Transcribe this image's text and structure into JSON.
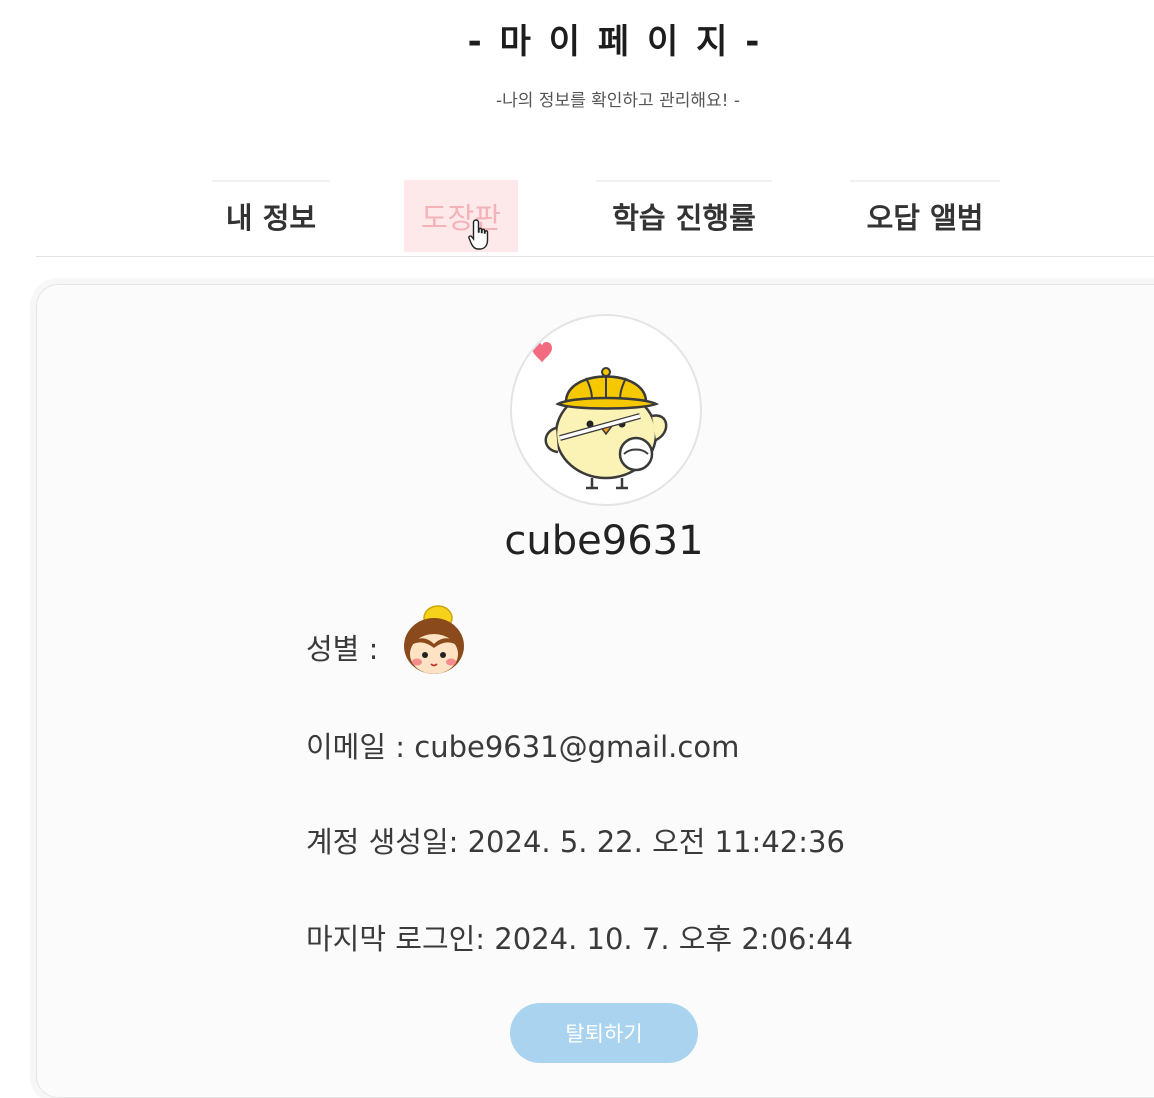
{
  "header": {
    "title": "- 마 이 페 이 지 -",
    "subtitle": "-나의 정보를 확인하고 관리해요! -"
  },
  "tabs": [
    {
      "label": "내 정보",
      "state": "default"
    },
    {
      "label": "도장판",
      "state": "hover"
    },
    {
      "label": "학습 진행률",
      "state": "default"
    },
    {
      "label": "오답 앨범",
      "state": "default"
    }
  ],
  "profile": {
    "avatar_icon": "chick-with-yellow-hat-icon",
    "username": "cube9631",
    "gender_label": "성별 :",
    "gender_icon": "boy-face-icon",
    "email_text": "이메일 : cube9631@gmail.com",
    "created_text": "계정 생성일: 2024. 5. 22. 오전 11:42:36",
    "last_login_text": "마지막 로그인: 2024. 10. 7. 오후 2:06:44",
    "withdraw_label": "탈퇴하기"
  },
  "colors": {
    "tab_hover_bg": "#fde8ea",
    "tab_hover_text": "#f4b3b9",
    "button_bg": "#a9d3ee"
  }
}
